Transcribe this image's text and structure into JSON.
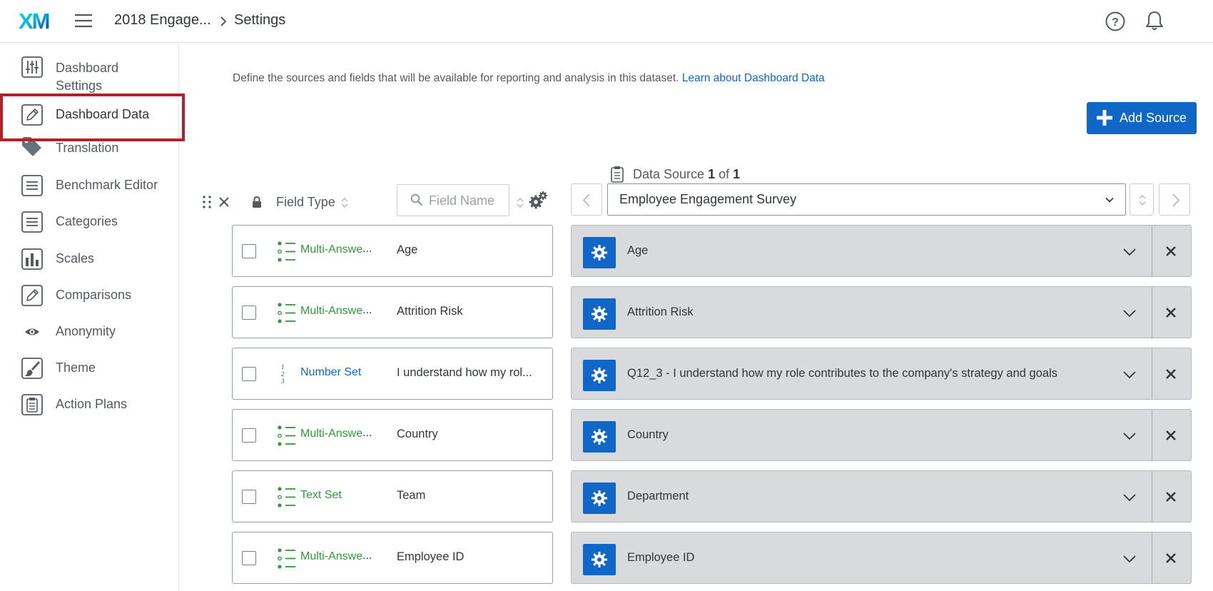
{
  "topbar": {
    "logo_text": "XM",
    "breadcrumb_project": "2018 Engage...",
    "breadcrumb_current": "Settings"
  },
  "sidebar": {
    "items": [
      {
        "label_line1": "Dashboard",
        "label_line2": "Settings",
        "icon": "sliders-icon"
      },
      {
        "label": "Dashboard Data",
        "icon": "pencil-square-icon",
        "active": true
      },
      {
        "label": "Translation",
        "icon": "tag-icon"
      },
      {
        "label": "Benchmark Editor",
        "icon": "list-icon"
      },
      {
        "label": "Categories",
        "icon": "list-icon"
      },
      {
        "label": "Scales",
        "icon": "bar-chart-icon"
      },
      {
        "label": "Comparisons",
        "icon": "pencil-square-icon"
      },
      {
        "label": "Anonymity",
        "icon": "eye-icon"
      },
      {
        "label": "Theme",
        "icon": "paintbrush-icon"
      },
      {
        "label": "Action Plans",
        "icon": "clipboard-icon"
      }
    ]
  },
  "main": {
    "description": "Define the sources and fields that will be available for reporting and analysis in this dataset.",
    "learn_link": "Learn about Dashboard Data",
    "add_source_label": "Add Source",
    "data_source_prefix": "Data Source",
    "data_source_current": "1",
    "data_source_of": "of",
    "data_source_total": "1",
    "field_type_label": "Field Type",
    "field_name_placeholder": "Field Name",
    "selected_source": "Employee Engagement Survey"
  },
  "rows": [
    {
      "type": "Multi-Answe",
      "type_color": "green",
      "field": "Age",
      "mapped": "Age"
    },
    {
      "type": "Multi-Answe",
      "type_color": "green",
      "field": "Attrition Risk",
      "mapped": "Attrition Risk"
    },
    {
      "type": "Number Set",
      "type_color": "blue",
      "field": "I understand how my rol...",
      "mapped": "Q12_3 - I understand how my role contributes to the company's strategy and goals"
    },
    {
      "type": "Multi-Answe",
      "type_color": "green",
      "field": "Country",
      "mapped": "Country"
    },
    {
      "type": "Text Set",
      "type_color": "green",
      "field": "Team",
      "mapped": "Department"
    },
    {
      "type": "Multi-Answe",
      "type_color": "green",
      "field": "Employee ID",
      "mapped": "Employee ID"
    }
  ],
  "colors": {
    "accent": "#1067c7",
    "highlight": "#b1202b",
    "multi_answer": "#2e9a3a",
    "number_set": "#1067c7"
  }
}
